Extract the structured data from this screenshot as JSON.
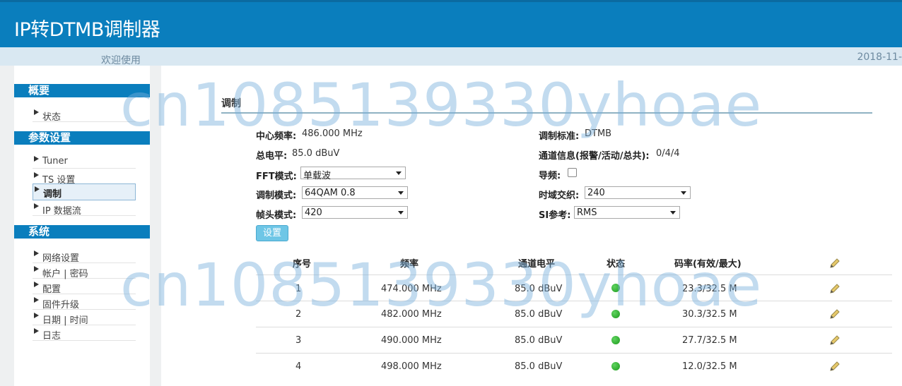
{
  "header": {
    "title": "IP转DTMB调制器"
  },
  "subbar": {
    "welcome": "欢迎使用",
    "date": "2018-11-"
  },
  "sidebar": {
    "sections": [
      {
        "title": "概要",
        "items": [
          "状态"
        ]
      },
      {
        "title": "参数设置",
        "items": [
          "Tuner",
          "TS 设置",
          "调制",
          "IP 数据流"
        ]
      },
      {
        "title": "系统",
        "items": [
          "网络设置",
          "帐户 | 密码",
          "配置",
          "固件升级",
          "日期 | 时间",
          "日志"
        ]
      }
    ],
    "active_item": "调制"
  },
  "panel": {
    "title": "调制"
  },
  "form": {
    "center_freq": {
      "label": "中心频率:",
      "value": "486.000 MHz"
    },
    "total_level": {
      "label": "总电平:",
      "value": "85.0 dBuV"
    },
    "fft_mode": {
      "label": "FFT模式:",
      "value": "单载波"
    },
    "mod_mode": {
      "label": "调制模式:",
      "value": "64QAM 0.8"
    },
    "frame_header": {
      "label": "帧头模式:",
      "value": "420"
    },
    "mod_standard": {
      "label": "调制标准:",
      "value": "DTMB"
    },
    "channel_info": {
      "label": "通道信息(报警/活动/总共):",
      "value": "0/4/4"
    },
    "pilot": {
      "label": "导频:",
      "checked": false
    },
    "time_interleave": {
      "label": "时域交织:",
      "value": "240"
    },
    "si_ref": {
      "label": "SI参考:",
      "value": "RMS"
    },
    "set_button": "设置"
  },
  "table": {
    "headers": [
      "序号",
      "频率",
      "通道电平",
      "状态",
      "码率(有效/最大)"
    ],
    "rows": [
      {
        "index": "1",
        "freq": "474.000 MHz",
        "level": "85.0 dBuV",
        "status": "ok",
        "rate": "23.3/32.5 M"
      },
      {
        "index": "2",
        "freq": "482.000 MHz",
        "level": "85.0 dBuV",
        "status": "ok",
        "rate": "30.3/32.5 M"
      },
      {
        "index": "3",
        "freq": "490.000 MHz",
        "level": "85.0 dBuV",
        "status": "ok",
        "rate": "27.7/32.5 M"
      },
      {
        "index": "4",
        "freq": "498.000 MHz",
        "level": "85.0 dBuV",
        "status": "ok",
        "rate": "12.0/32.5 M"
      }
    ]
  },
  "icons": {
    "edit": "pencil-icon",
    "status_ok": "green-dot-icon",
    "nav_arrow": "triangle-right-icon"
  },
  "colors": {
    "brand": "#0a7ebd",
    "subbar": "#d9e8f2",
    "button": "#6ec6e6",
    "status_ok": "#22aa22"
  },
  "watermark": "cn1085139330yhoae"
}
